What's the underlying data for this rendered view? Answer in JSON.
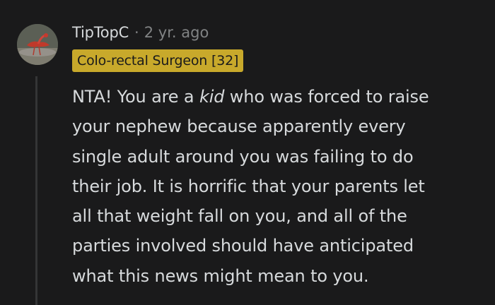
{
  "comment": {
    "author": "TipTopC",
    "separator": "·",
    "timestamp": "2 yr. ago",
    "flair": "Colo-rectal Surgeon [32]",
    "body_lines": [
      [
        "NTA! You are a ",
        "kid",
        " who was forced to raise"
      ],
      "your nephew because apparently every",
      "single adult around you was failing to do",
      "their job. It is horrific that your parents let",
      "all that weight fall on you, and all of the",
      "parties involved should have anticipated",
      "what this news might mean to you."
    ],
    "colors": {
      "background": "#1a1a1b",
      "text": "#d7dadc",
      "muted": "#818384",
      "flair_background": "#c8a92b",
      "flair_text": "#1a1a1b",
      "thread_line": "#343536"
    },
    "avatar_icon": "bird-photo-avatar"
  }
}
